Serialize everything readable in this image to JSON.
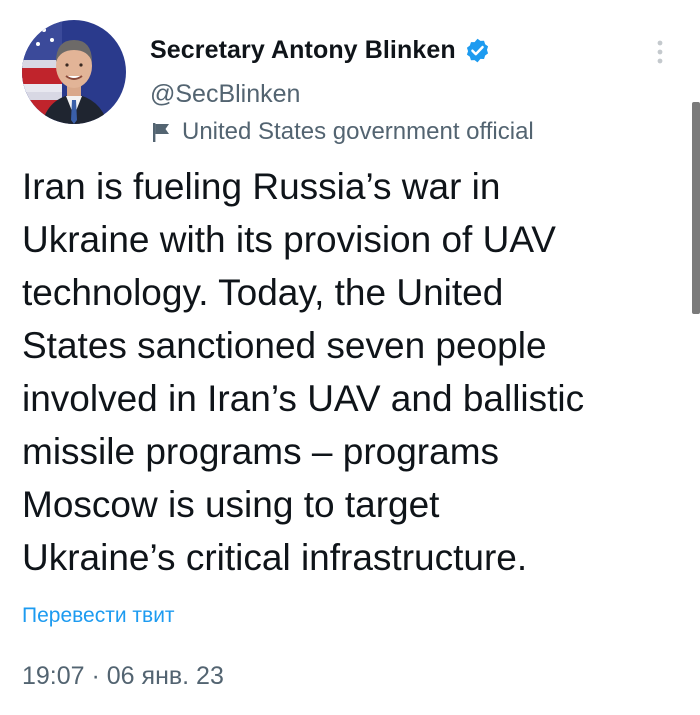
{
  "author": {
    "display_name": "Secretary Antony Blinken",
    "handle": "@SecBlinken",
    "affiliation": "United States government official",
    "verified_icon": "verified-badge-icon",
    "affiliation_icon": "flag-icon",
    "avatar_icon": "profile-photo"
  },
  "tweet": {
    "text": "Iran is fueling Russia’s war in\nUkraine with its provision of UAV\ntechnology. Today, the United\nStates sanctioned seven people\ninvolved in Iran’s UAV and ballistic\nmissile programs – programs\nMoscow is using to target\nUkraine’s critical infrastructure.",
    "translate_label": "Перевести твит",
    "timestamp": "19:07 · 06 янв. 23"
  },
  "menu": {
    "more_icon": "more-options-icon"
  },
  "colors": {
    "text_primary": "#0f1419",
    "text_secondary": "#536471",
    "link": "#1d9bf0",
    "verified": "#1d9bf0"
  }
}
